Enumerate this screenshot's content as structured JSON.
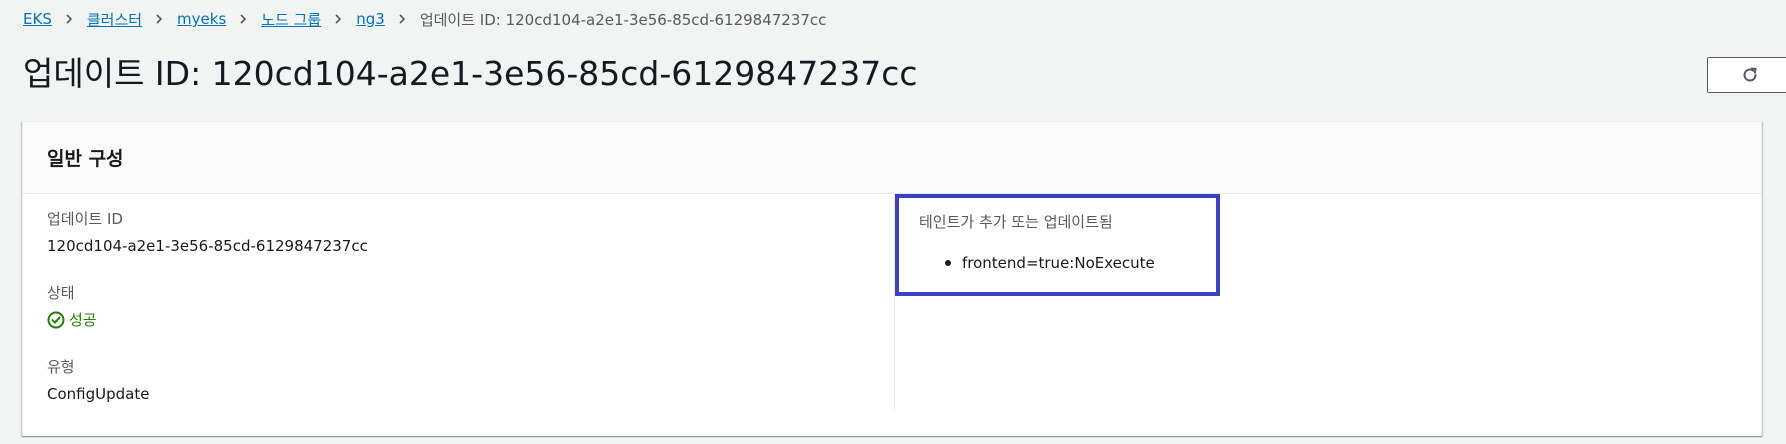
{
  "breadcrumb": {
    "items": [
      {
        "label": "EKS"
      },
      {
        "label": "클러스터"
      },
      {
        "label": "myeks"
      },
      {
        "label": "노드 그룹"
      },
      {
        "label": "ng3"
      }
    ],
    "current": "업데이트 ID: 120cd104-a2e1-3e56-85cd-6129847237cc"
  },
  "header": {
    "title": "업데이트 ID: 120cd104-a2e1-3e56-85cd-6129847237cc",
    "refresh_icon": "refresh-icon"
  },
  "panel": {
    "title": "일반 구성",
    "fields": {
      "update_id": {
        "label": "업데이트 ID",
        "value": "120cd104-a2e1-3e56-85cd-6129847237cc"
      },
      "status": {
        "label": "상태",
        "value": "성공",
        "icon": "success-check-icon",
        "color": "#1d8102"
      },
      "type": {
        "label": "유형",
        "value": "ConfigUpdate"
      }
    },
    "taints": {
      "label": "테인트가 추가 또는 업데이트됨",
      "items": [
        "frontend=true:NoExecute"
      ],
      "highlight_color": "#3d3fc4"
    }
  }
}
